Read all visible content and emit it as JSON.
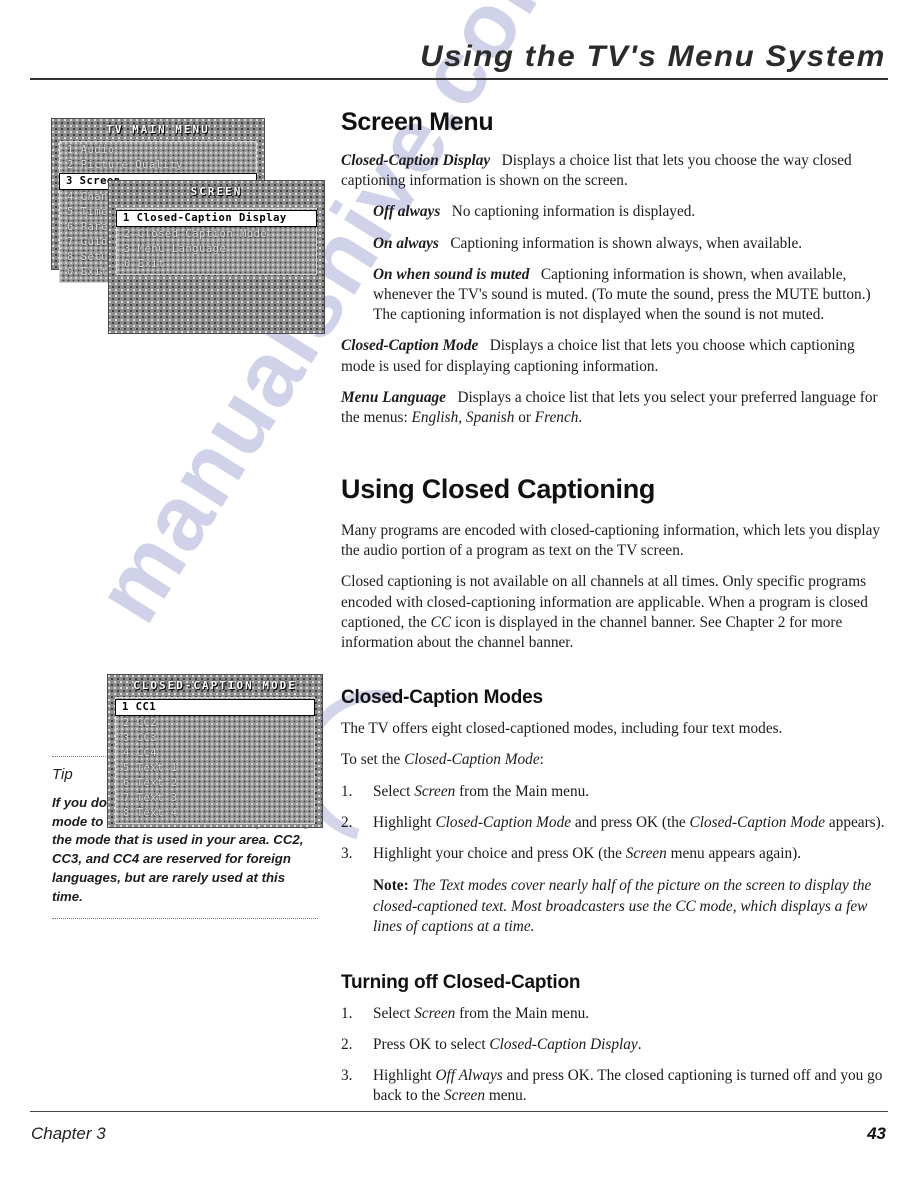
{
  "header": {
    "title": "Using the TV's Menu System"
  },
  "footer": {
    "chapter": "Chapter 3",
    "page_number": "43"
  },
  "watermark": {
    "text": "manualshive.com",
    "color": "#a9aed6"
  },
  "graphics": {
    "main_menu": {
      "title": "TV MAIN MENU",
      "items": [
        {
          "label": "1 Audio",
          "selected": false
        },
        {
          "label": "2 Picture Quality",
          "selected": false
        },
        {
          "label": "3 Screen",
          "selected": true
        },
        {
          "label": "4 Channel",
          "selected": false
        },
        {
          "label": "5 Time",
          "selected": false
        },
        {
          "label": "6 Parental",
          "selected": false
        },
        {
          "label": "7 Guide",
          "selected": false
        },
        {
          "label": "8 Setup",
          "selected": false
        },
        {
          "label": "0 Exit",
          "selected": false
        }
      ]
    },
    "screen_menu": {
      "title": "SCREEN",
      "items": [
        {
          "label": "1 Closed-Caption Display",
          "selected": true
        },
        {
          "label": "2 Closed-Caption Mode",
          "selected": false
        },
        {
          "label": "3 Menu Language",
          "selected": false
        },
        {
          "label": "0 Exit",
          "selected": false
        }
      ]
    },
    "cc_mode_menu": {
      "title": "CLOSED-CAPTION MODE",
      "items": [
        {
          "label": "1 CC1",
          "selected": true
        },
        {
          "label": "2 CC2",
          "selected": false
        },
        {
          "label": "3 CC3",
          "selected": false
        },
        {
          "label": "4 CC4",
          "selected": false
        },
        {
          "label": "5 Text 1",
          "selected": false
        },
        {
          "label": "6 Text 2",
          "selected": false
        },
        {
          "label": "7 Text 3",
          "selected": false
        },
        {
          "label": "8 Text 4",
          "selected": false
        }
      ]
    }
  },
  "tip": {
    "label": "Tip",
    "text": "If you don't know which Closed-Caption mode to use, select CC1. CC1 is probably the mode that is used in your area. CC2, CC3, and CC4 are reserved for foreign languages, but are rarely used at this time."
  },
  "screen_menu_section": {
    "heading": "Screen Menu",
    "cc_display": {
      "lead": "Closed-Caption Display",
      "text": "Displays a choice list that lets you choose the way closed captioning information is shown on the screen."
    },
    "options": [
      {
        "lead": "Off always",
        "text": "No captioning information is displayed."
      },
      {
        "lead": "On always",
        "text": "Captioning information is shown always, when available."
      },
      {
        "lead": "On when sound is muted",
        "text": "Captioning information is shown, when available, whenever the TV's sound is muted. (To mute the sound, press the MUTE button.) The captioning information is not displayed when the sound is not muted."
      }
    ],
    "cc_mode": {
      "lead": "Closed-Caption Mode",
      "text": "Displays a choice list that lets you choose which captioning mode is used for displaying captioning information."
    },
    "menu_language": {
      "lead": "Menu Language",
      "text_before": "Displays a choice list that lets you select your preferred language for the menus: ",
      "languages": "English, Spanish",
      "conjunction": " or ",
      "last_language": "French",
      "text_after": "."
    }
  },
  "using_cc_section": {
    "heading": "Using Closed Captioning",
    "paragraph_1": "Many programs are encoded with closed-captioning information, which lets you display the audio portion of a program as text on the TV screen.",
    "paragraph_2_part1": "Closed captioning is not available on all channels at all times. Only specific programs encoded with closed-captioning information are applicable. When a program is closed captioned, the ",
    "paragraph_2_italic": "CC",
    "paragraph_2_part2": " icon is displayed in the channel banner. See Chapter 2 for more information about the channel banner."
  },
  "cc_modes_section": {
    "heading": "Closed-Caption Modes",
    "intro": "The TV offers eight closed-captioned modes, including four text modes.",
    "to_set_prefix": "To set the ",
    "to_set_italic": "Closed-Caption Mode",
    "to_set_suffix": ":",
    "steps": [
      {
        "num": "1.",
        "parts": [
          "Select ",
          "Screen",
          " from the Main menu."
        ]
      },
      {
        "num": "2.",
        "parts": [
          "Highlight ",
          "Closed-Caption Mode",
          " and press OK  (the ",
          "Closed-Caption Mode",
          " appears)."
        ]
      },
      {
        "num": "3.",
        "parts": [
          "Highlight your choice and press OK (the ",
          "Screen",
          " menu appears again)."
        ]
      }
    ],
    "note_label": "Note:",
    "note_text": " The Text modes cover nearly half of the picture on the screen to display the closed-captioned text. Most broadcasters use the CC mode, which displays a few lines of captions at a time."
  },
  "turning_off_section": {
    "heading": "Turning off Closed-Caption",
    "steps": [
      {
        "num": "1.",
        "parts": [
          "Select ",
          "Screen",
          " from the Main menu."
        ]
      },
      {
        "num": "2.",
        "parts": [
          "Press OK to select ",
          "Closed-Caption Display",
          "."
        ]
      },
      {
        "num": "3.",
        "parts": [
          "Highlight ",
          "Off Always",
          " and press OK. The closed captioning is turned off and you go back to the ",
          "Screen",
          " menu."
        ]
      }
    ]
  }
}
